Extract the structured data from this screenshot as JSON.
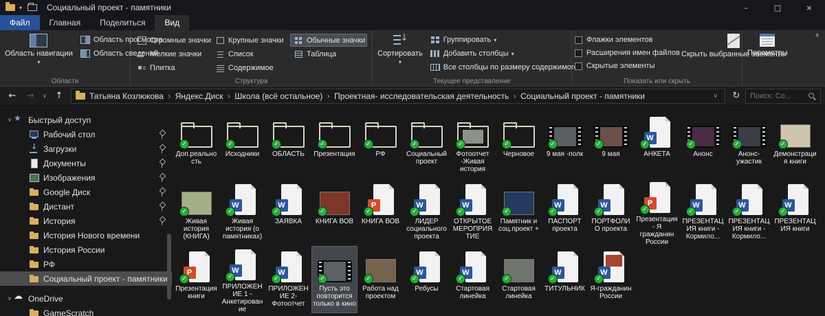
{
  "colors": {
    "accent_blue": "#27529b",
    "sync_green": "#2bab3c",
    "word_blue": "#2b579a",
    "ppt_orange": "#d04e2a",
    "folder_yellow": "#d8ae5f",
    "selection_gray": "#43464d"
  },
  "icons": {
    "minimize": "–",
    "maximize": "□",
    "close": "×",
    "back": "←",
    "forward": "→",
    "up": "↑",
    "refresh": "↻",
    "dropdown": "∨",
    "dropdown_small": "▾",
    "collapse": "∧"
  },
  "window": {
    "title": "Социальный проект - памятники"
  },
  "tabs": [
    {
      "label": "Файл",
      "kind": "file"
    },
    {
      "label": "Главная",
      "kind": "normal"
    },
    {
      "label": "Поделиться",
      "kind": "normal"
    },
    {
      "label": "Вид",
      "kind": "active"
    }
  ],
  "ribbon": {
    "panes_group": {
      "label": "Области",
      "nav_button": "Область навигации",
      "buttons": [
        {
          "label": "Область просмотра",
          "icon": "preview"
        },
        {
          "label": "Область сведений",
          "icon": "details"
        }
      ]
    },
    "layout_group": {
      "label": "Структура",
      "options": [
        {
          "label": "Огромные значки",
          "icon": "ixl",
          "selected": false
        },
        {
          "label": "Крупные значки",
          "icon": "il",
          "selected": false
        },
        {
          "label": "Обычные значки",
          "icon": "im",
          "selected": true
        },
        {
          "label": "Мелкие значки",
          "icon": "is",
          "selected": false
        },
        {
          "label": "Список",
          "icon": "list",
          "selected": false
        },
        {
          "label": "Таблица",
          "icon": "table",
          "selected": false
        },
        {
          "label": "Плитка",
          "icon": "tiles",
          "selected": false
        },
        {
          "label": "Содержимое",
          "icon": "content",
          "selected": false
        }
      ]
    },
    "view_group": {
      "label": "Текущее представление",
      "sort_button": "Сортировать",
      "buttons": [
        {
          "label": "Группировать",
          "icon": "group",
          "dd": true
        },
        {
          "label": "Добавить столбцы",
          "icon": "addcols",
          "dd": true
        },
        {
          "label": "Все столбцы по размеру содержимого",
          "icon": "fitcols",
          "dd": false
        }
      ]
    },
    "show_group": {
      "label": "Показать или скрыть",
      "checkboxes": [
        {
          "label": "Флажки элементов",
          "checked": false
        },
        {
          "label": "Расширения имен файлов",
          "checked": false
        },
        {
          "label": "Скрытые элементы",
          "checked": false
        }
      ],
      "hide_button": "Скрыть выбранные элементы"
    },
    "options_group": {
      "options_button": "Параметры"
    }
  },
  "address_bar": {
    "breadcrumbs": [
      {
        "label": "Татьяна Козлюкова"
      },
      {
        "label": "Яндекс.Диск"
      },
      {
        "label": "Школа (всё остальное)"
      },
      {
        "label": "Проектная- исследовательская  деятельность"
      },
      {
        "label": "Социальный проект - памятники"
      }
    ],
    "search_placeholder": "Поиск: Со..."
  },
  "sidebar": {
    "items": [
      {
        "label": "Быстрый доступ",
        "icon": "star",
        "level": 0,
        "expander": "∨"
      },
      {
        "label": "Рабочий стол",
        "icon": "desktop",
        "level": 1,
        "pinned": true
      },
      {
        "label": "Загрузки",
        "icon": "download",
        "level": 1,
        "pinned": true
      },
      {
        "label": "Документы",
        "icon": "doc",
        "level": 1,
        "pinned": true
      },
      {
        "label": "Изображения",
        "icon": "pic",
        "level": 1,
        "pinned": true
      },
      {
        "label": "Google Диск",
        "icon": "folder",
        "level": 1,
        "pinned": true
      },
      {
        "label": "Дистант",
        "icon": "folder",
        "level": 1,
        "pinned": true
      },
      {
        "label": "История",
        "icon": "folder",
        "level": 1,
        "pinned": true
      },
      {
        "label": "История Нового времени",
        "icon": "folder",
        "level": 1
      },
      {
        "label": "История России",
        "icon": "folder",
        "level": 1
      },
      {
        "label": "РФ",
        "icon": "folder",
        "level": 1
      },
      {
        "label": "Социальный проект - памятники",
        "icon": "folder",
        "level": 1,
        "selected": true
      },
      {
        "label": "OneDrive",
        "icon": "cloud",
        "level": 0,
        "expander": "∨"
      },
      {
        "label": "GameScratch",
        "icon": "folder",
        "level": 1
      }
    ]
  },
  "files": [
    {
      "label": "Доп.реальность",
      "type": "folder"
    },
    {
      "label": "Исходники",
      "type": "folder"
    },
    {
      "label": "ОБЛАСТЬ",
      "type": "folder"
    },
    {
      "label": "Презентация",
      "type": "folder"
    },
    {
      "label": "РФ",
      "type": "folder"
    },
    {
      "label": "Социальный проект",
      "type": "folder"
    },
    {
      "label": "Фотоотчет -Живая история",
      "type": "folderimg",
      "thumb": "#8d9288"
    },
    {
      "label": "Черновое",
      "type": "folder"
    },
    {
      "label": "9 мая -полк",
      "type": "video",
      "thumb": "#5b5e63"
    },
    {
      "label": "9 мая",
      "type": "video",
      "thumb": "#6b5148"
    },
    {
      "label": "АНКЕТА",
      "type": "word"
    },
    {
      "label": "Анонс",
      "type": "video",
      "thumb": "#4a2b44"
    },
    {
      "label": "Анонс-ужастик",
      "type": "video",
      "thumb": "#3a3d44"
    },
    {
      "label": "Демонстрация книги",
      "type": "image",
      "thumb": "#cfc5ae"
    },
    {
      "label": "Живая история (КНИГА)",
      "type": "image",
      "thumb": "#a3b086"
    },
    {
      "label": "Живая история (о памятниках)",
      "type": "word"
    },
    {
      "label": "ЗАЯВКА",
      "type": "word"
    },
    {
      "label": "КНИГА ВОВ",
      "type": "image",
      "thumb": "#7e352a"
    },
    {
      "label": "КНИГА ВОВ",
      "type": "ppt"
    },
    {
      "label": "ЛИДЕР социального проекта",
      "type": "word"
    },
    {
      "label": "ОТКРЫТОЕ МЕРОПРИЯТИЕ",
      "type": "word"
    },
    {
      "label": "Памятник и соц.проект +",
      "type": "image",
      "thumb": "#243a5e"
    },
    {
      "label": "ПАСПОРТ проекта",
      "type": "word"
    },
    {
      "label": "ПОРТФОЛИО проекта",
      "type": "word"
    },
    {
      "label": "Презентация - Я гражданин России",
      "type": "ppt"
    },
    {
      "label": "ПРЕЗЕНТАЦИЯ книги - Кормило...",
      "type": "word"
    },
    {
      "label": "ПРЕЗЕНТАЦИЯ книги - Кормило...",
      "type": "word"
    },
    {
      "label": "ПРЕЗЕНТАЦИЯ книги",
      "type": "word"
    },
    {
      "label": "Презентация книги",
      "type": "ppt"
    },
    {
      "label": "ПРИЛОЖЕНИЕ 1 - Анкетирование",
      "type": "word"
    },
    {
      "label": "ПРИЛОЖЕНИЕ 2- Фотоотчет",
      "type": "word"
    },
    {
      "label": "Пусть это повторится только в кино",
      "type": "video",
      "thumb": "#5a6268",
      "selected": true
    },
    {
      "label": "Работа над проектом",
      "type": "image",
      "thumb": "#77624f"
    },
    {
      "label": "Ребусы",
      "type": "word"
    },
    {
      "label": "Стартовая линейка",
      "type": "word"
    },
    {
      "label": "Стартовая линейка",
      "type": "image",
      "thumb": "#6f766e"
    },
    {
      "label": "ТИТУЛЬНИК",
      "type": "word"
    },
    {
      "label": "Я-гражданин России",
      "type": "wordimg",
      "thumb": "#a8432f"
    }
  ]
}
